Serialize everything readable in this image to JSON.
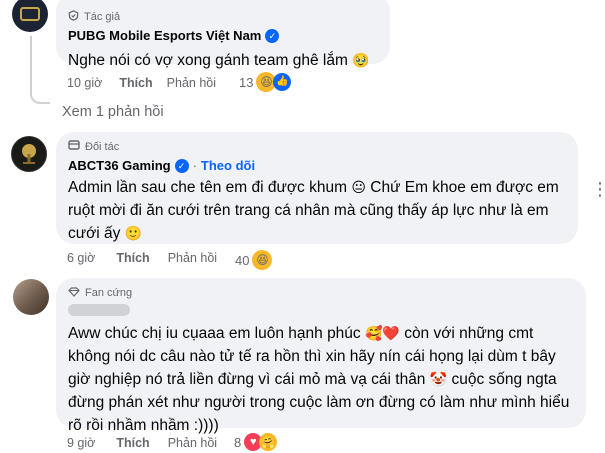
{
  "comment1": {
    "badge": "Tác giả",
    "badge_icon": "author-shield-icon",
    "author": "PUBG Mobile Esports Việt Nam",
    "verified": true,
    "text": "Nghe nói có vợ xong gánh team ghê lắm",
    "text_emoji": "🥹",
    "time": "10 giờ",
    "like": "Thích",
    "reply": "Phản hồi",
    "reaction_count": "13",
    "reactions": [
      "haha-emoji",
      "like-emoji"
    ]
  },
  "view_replies": "Xem 1 phản hồi",
  "comment2": {
    "badge": "Đối tác",
    "badge_icon": "partner-icon",
    "author": "ABCT36 Gaming",
    "verified": true,
    "follow": "Theo dõi",
    "separator": "·",
    "text_part1": "Admin lần sau che tên em đi được khum",
    "emoji1": "😐",
    "text_part2": "Chứ Em khoe em được em ruột mời đi ăn cưới trên trang cá nhân mà cũng thấy áp lực như là em cưới ấy",
    "emoji2": "🙂",
    "time": "6 giờ",
    "like": "Thích",
    "reply": "Phản hồi",
    "reaction_count": "40",
    "reactions": [
      "haha-emoji"
    ]
  },
  "comment3": {
    "badge": "Fan cứng",
    "badge_icon": "diamond-icon",
    "text_part1": "Aww chúc chị iu cụaaa em luôn hạnh phúc",
    "emoji1": "🥰❤️",
    "text_part2": "còn với những cmt không nói dc câu nào tử tế ra hồn thì xin hãy nín cái họng lại dùm t bây giờ nghiệp nó trả liền đừng vì cái mỏ mà vạ cái thân",
    "emoji2": "🤡",
    "text_part3": "cuộc sống ngta đừng phán xét như người trong cuộc làm ơn đừng có làm như mình hiểu rõ rồi nhầm nhầm :))))",
    "time": "9 giờ",
    "like": "Thích",
    "reply": "Phản hồi",
    "reaction_count": "8",
    "reactions": [
      "love-emoji",
      "care-emoji"
    ]
  },
  "colors": {
    "bubble": "#f0f2f5",
    "meta_text": "#65676b",
    "link_blue": "#0866ff",
    "haha_yellow": "#f7b928",
    "love_red": "#f33e58"
  }
}
